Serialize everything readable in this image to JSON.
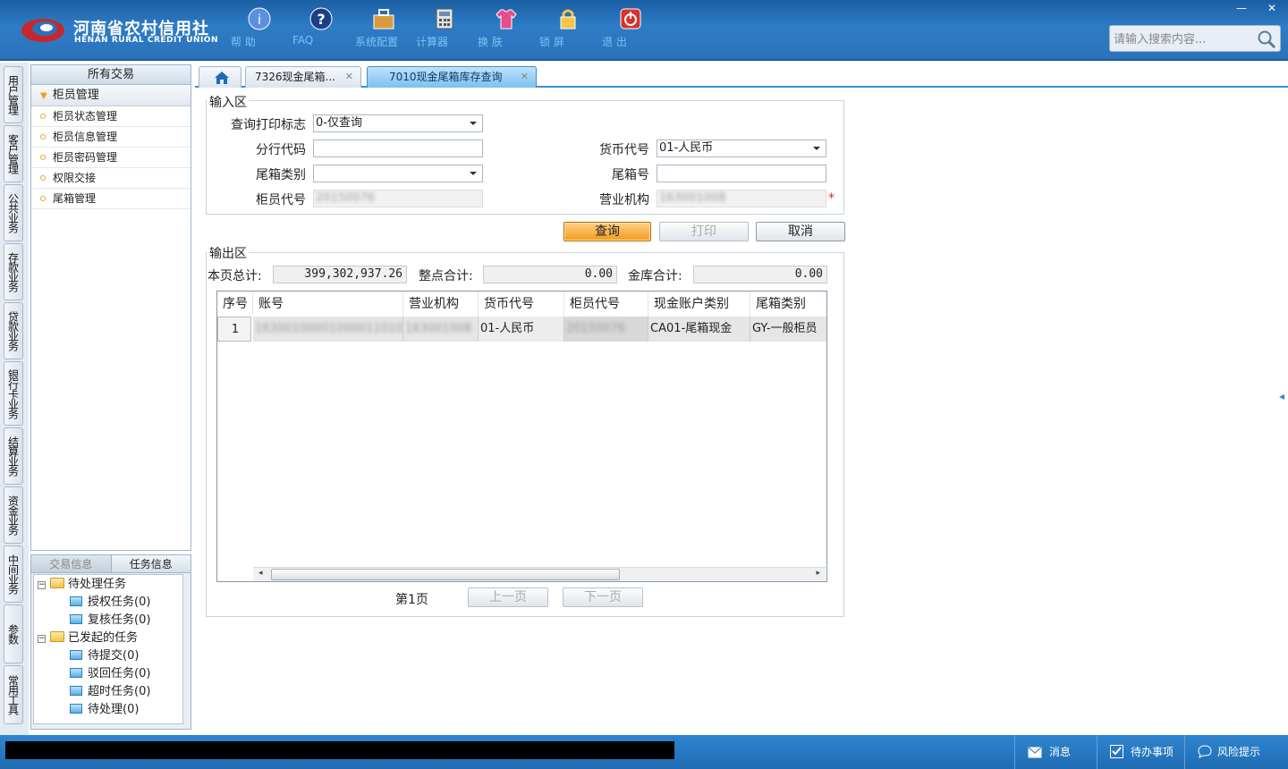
{
  "header": {
    "logo_cn": "河南省农村信用社",
    "logo_en": "HENAN RURAL CREDIT UNION",
    "toolbar": [
      {
        "label": "帮 助",
        "icon": "help-icon"
      },
      {
        "label": "FAQ",
        "icon": "faq-icon"
      },
      {
        "label": "系统配置",
        "icon": "toolbox-icon"
      },
      {
        "label": "计算器",
        "icon": "calculator-icon"
      },
      {
        "label": "换 肤",
        "icon": "shirt-icon"
      },
      {
        "label": "锁 屏",
        "icon": "lock-icon"
      },
      {
        "label": "退 出",
        "icon": "power-icon"
      }
    ],
    "search_placeholder": "请输入搜索内容..."
  },
  "left_tabs": [
    "用户管理",
    "客户管理",
    "公共业务",
    "存款业务",
    "贷款业务",
    "银行卡业务",
    "结算业务",
    "资金业务",
    "中间业务",
    "参数",
    "常用工具"
  ],
  "nav": {
    "header": "所有交易",
    "group": "柜员管理",
    "items": [
      "柜员状态管理",
      "柜员信息管理",
      "柜员密码管理",
      "权限交接",
      "尾箱管理"
    ]
  },
  "task_panel": {
    "tabs": [
      "交易信息",
      "任务信息"
    ],
    "tree": [
      {
        "label": "待处理任务",
        "level": 0
      },
      {
        "label": "授权任务(0)",
        "level": 1
      },
      {
        "label": "复核任务(0)",
        "level": 1
      },
      {
        "label": "已发起的任务",
        "level": 0
      },
      {
        "label": "待提交(0)",
        "level": 1
      },
      {
        "label": "驳回任务(0)",
        "level": 1
      },
      {
        "label": "超时任务(0)",
        "level": 1
      },
      {
        "label": "待处理(0)",
        "level": 1
      }
    ]
  },
  "tabs": [
    "7326现金尾箱...",
    "7010现金尾箱库存查询"
  ],
  "input_area": {
    "title": "输入区",
    "query_flag_label": "查询打印标志",
    "query_flag_value": "0-仅查询",
    "branch_label": "分行代码",
    "branch_value": "",
    "currency_label": "货币代号",
    "currency_value": "01-人民币",
    "box_type_label": "尾箱类别",
    "box_type_value": "",
    "box_no_label": "尾箱号",
    "box_no_value": "",
    "teller_label": "柜员代号",
    "teller_value": "20150076",
    "org_label": "营业机构",
    "org_value": "163001008",
    "required_mark": "*"
  },
  "buttons": {
    "query": "查询",
    "print": "打印",
    "cancel": "取消"
  },
  "output_area": {
    "title": "输出区",
    "page_total_label": "本页总计:",
    "page_total_value": "399,302,937.26",
    "whole_total_label": "整点合计:",
    "whole_total_value": "0.00",
    "vault_total_label": "金库合计:",
    "vault_total_value": "0.00"
  },
  "grid": {
    "columns": [
      "序号",
      "账号",
      "营业机构",
      "货币代号",
      "柜员代号",
      "现金账户类别",
      "尾箱类别"
    ],
    "rows": [
      [
        "1",
        "163001000010000110101",
        "163001008",
        "01-人民币",
        "20150076",
        "CA01-尾箱现金",
        "GY-一般柜员"
      ]
    ]
  },
  "pager": {
    "page": "第1页",
    "prev": "上一页",
    "next": "下一页"
  },
  "statusbar": {
    "message": "消息",
    "todo": "待办事项",
    "risk": "风险提示"
  }
}
